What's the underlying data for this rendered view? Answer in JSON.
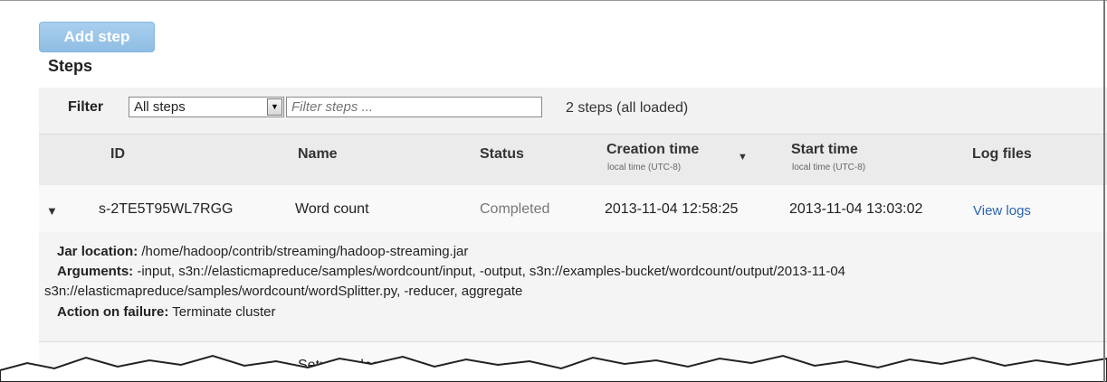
{
  "toolbar": {
    "add_step_label": "Add step"
  },
  "section": {
    "title": "Steps"
  },
  "filter": {
    "label": "Filter",
    "selected": "All steps",
    "placeholder": "Filter steps ...",
    "count": "2 steps (all loaded)"
  },
  "columns": {
    "id": "ID",
    "name": "Name",
    "status": "Status",
    "creation": "Creation time",
    "creation_sub": "local time (UTC-8)",
    "start": "Start time",
    "start_sub": "local time (UTC-8)",
    "logs": "Log files"
  },
  "rows": [
    {
      "id": "s-2TE5T95WL7RGG",
      "name": "Word count",
      "status": "Completed",
      "creation": "2013-11-04 12:58:25",
      "start": "2013-11-04 13:03:02",
      "logs": "View logs",
      "details": {
        "jar_label": "Jar location:",
        "jar_value": "/home/hadoop/contrib/streaming/hadoop-streaming.jar",
        "args_label": "Arguments:",
        "args_line1": "-input, s3n://elasticmapreduce/samples/wordcount/input, -output, s3n://examples-bucket/wordcount/output/2013-11-04",
        "args_line2": "s3n://elasticmapreduce/samples/wordcount/wordSplitter.py, -reducer, aggregate",
        "failure_label": "Action on failure:",
        "failure_value": "Terminate cluster"
      }
    },
    {
      "name": "Setup hadoop"
    }
  ],
  "colors": {
    "accent": "#2a64b3",
    "button": "#9cc6ea",
    "panel": "#f2f2f2"
  }
}
